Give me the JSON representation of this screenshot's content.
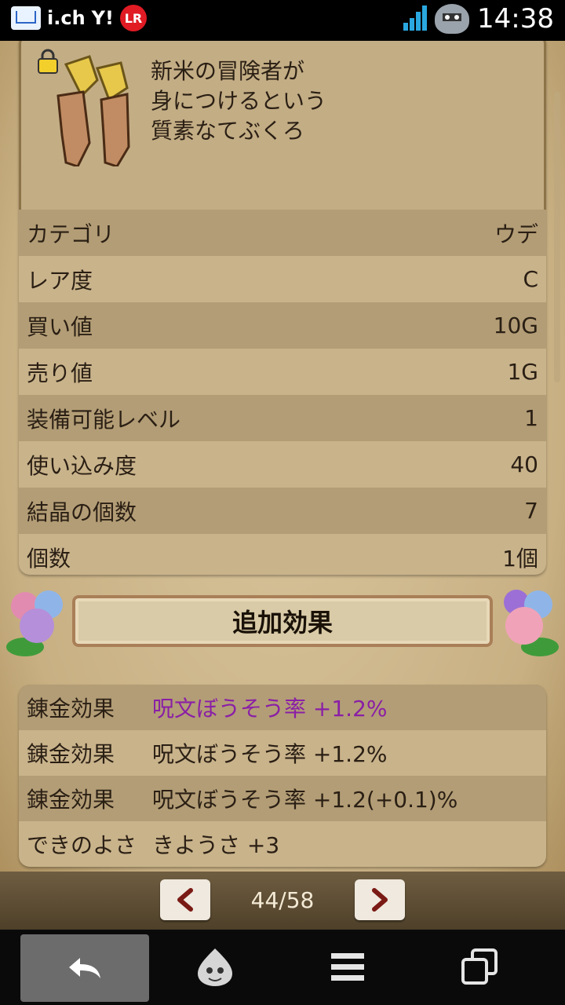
{
  "statusbar": {
    "left_icons": [
      "mail-icon",
      "ich-icon",
      "yahoo-icon",
      "lr-icon"
    ],
    "ich_label": "i.ch",
    "yahoo_label": "Y!",
    "lr_label": "LR",
    "right_icons": [
      "signal-icon",
      "slime-notification-icon"
    ],
    "time": "14:38"
  },
  "item": {
    "description": "新米の冒険者が\n身につけるという\n質素なてぶくろ",
    "rows": [
      {
        "label": "カテゴリ",
        "value": "ウデ"
      },
      {
        "label": "レア度",
        "value": "C"
      },
      {
        "label": "買い値",
        "value": "10G"
      },
      {
        "label": "売り値",
        "value": "1G"
      },
      {
        "label": "装備可能レベル",
        "value": "1"
      },
      {
        "label": "使い込み度",
        "value": "40"
      },
      {
        "label": "結晶の個数",
        "value": "7"
      },
      {
        "label": "個数",
        "value": "1個"
      }
    ]
  },
  "effects": {
    "title": "追加効果",
    "rows": [
      {
        "label": "錬金効果",
        "value": "呪文ぼうそう率 +1.2%"
      },
      {
        "label": "錬金効果",
        "value": "呪文ぼうそう率 +1.2%"
      },
      {
        "label": "錬金効果",
        "value": "呪文ぼうそう率 +1.2(+0.1)%"
      },
      {
        "label": "できのよさ",
        "value": "きようさ +3"
      }
    ],
    "highlight_color": "#8a1fa6"
  },
  "pager": {
    "prev_icon": "chevron-left-icon",
    "next_icon": "chevron-right-icon",
    "page_text": "44/58"
  },
  "navbar": {
    "icons": [
      "back-icon",
      "slime-home-icon",
      "menu-icon",
      "windows-icon"
    ]
  },
  "colors": {
    "parchment": "#cbb58a",
    "row_dark": "#b39d76",
    "row_light": "#c9b38b"
  }
}
